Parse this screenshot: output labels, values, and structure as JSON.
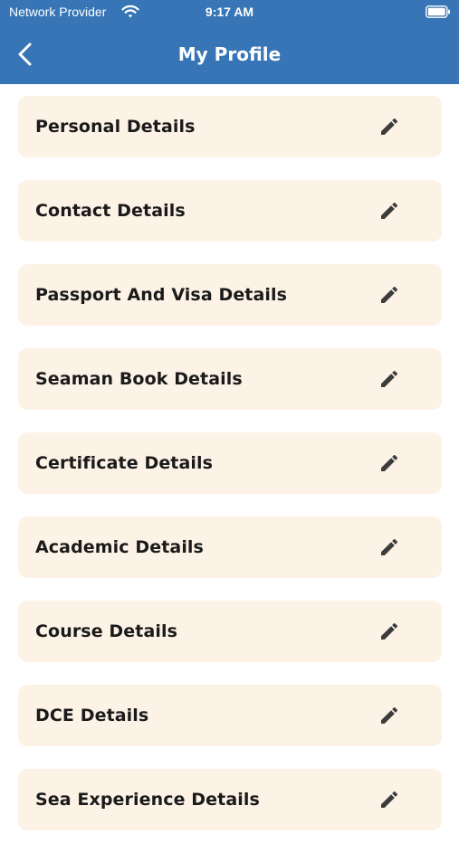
{
  "status_bar": {
    "carrier": "Network Provider",
    "time": "9:17 AM",
    "wifi_icon": "wifi-icon",
    "battery_icon": "battery-icon"
  },
  "header": {
    "title": "My Profile",
    "back_icon": "chevron-left-icon",
    "background_color": "#3775b6"
  },
  "sections": [
    {
      "label": "Personal Details",
      "icon": "pencil-icon"
    },
    {
      "label": "Contact Details",
      "icon": "pencil-icon"
    },
    {
      "label": "Passport And Visa Details",
      "icon": "pencil-icon"
    },
    {
      "label": "Seaman Book Details",
      "icon": "pencil-icon"
    },
    {
      "label": "Certificate Details",
      "icon": "pencil-icon"
    },
    {
      "label": "Academic Details",
      "icon": "pencil-icon"
    },
    {
      "label": "Course Details",
      "icon": "pencil-icon"
    },
    {
      "label": "DCE Details",
      "icon": "pencil-icon"
    },
    {
      "label": "Sea Experience Details",
      "icon": "pencil-icon"
    }
  ],
  "colors": {
    "card_background": "#fdf2e6",
    "text": "#1a1a1a",
    "icon": "#3c3c3c"
  }
}
